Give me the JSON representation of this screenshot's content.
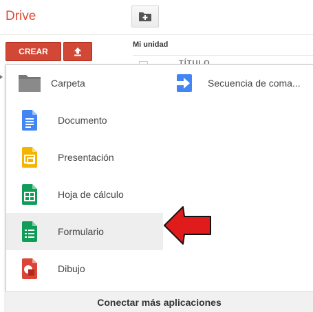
{
  "app": {
    "title": "Drive"
  },
  "toolbar": {
    "create_label": "CREAR"
  },
  "main": {
    "section_title": "Mi unidad",
    "background_row_title": "TÍTULO"
  },
  "menu": {
    "items": [
      {
        "label": "Carpeta",
        "icon": "folder-icon"
      },
      {
        "label": "Secuencia de coma...",
        "icon": "script-arrow-icon"
      },
      {
        "label": "Documento",
        "icon": "docs-icon"
      },
      {
        "label": "Presentación",
        "icon": "slides-icon"
      },
      {
        "label": "Hoja de cálculo",
        "icon": "sheets-icon"
      },
      {
        "label": "Formulario",
        "icon": "forms-icon",
        "highlighted": true
      },
      {
        "label": "Dibujo",
        "icon": "drawings-icon"
      }
    ],
    "footer_label": "Conectar más aplicaciones"
  },
  "colors": {
    "brand": "#dd4b39",
    "create_button": "#d14836",
    "docs": "#4285f4",
    "slides": "#f4b400",
    "sheets": "#0f9d58",
    "forms": "#0f9d58",
    "drawings": "#db4437",
    "arrow": "#e01b1b"
  }
}
